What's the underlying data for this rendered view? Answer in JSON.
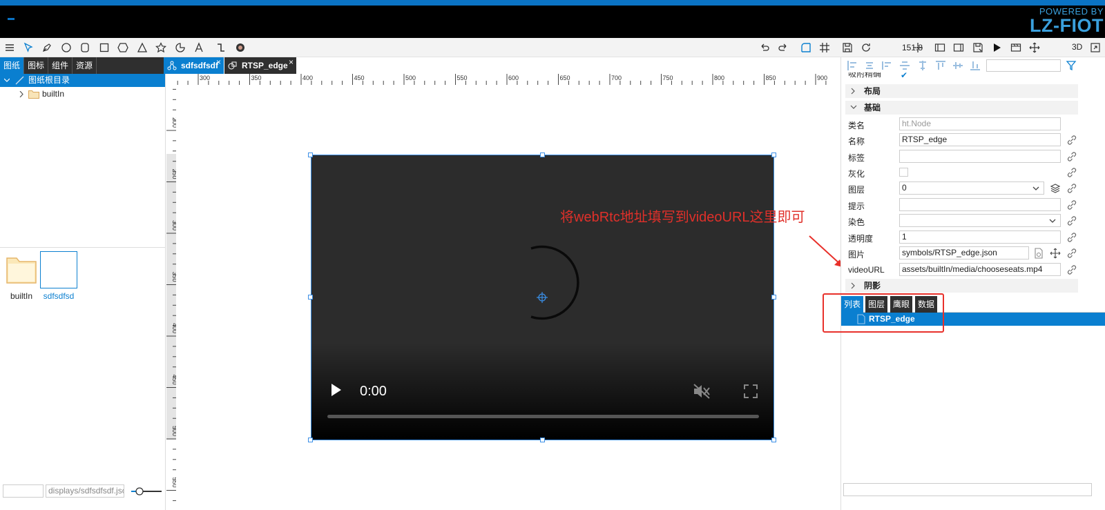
{
  "header": {
    "powered_by": "POWERED BY",
    "brand": "LZ-FIOT"
  },
  "toolbar": {
    "zoom": "151.8",
    "three_d": "3D"
  },
  "left_panel": {
    "tabs": [
      "图纸",
      "图标",
      "组件",
      "资源"
    ],
    "tree_root": "图纸根目录",
    "tree_child": "builtIn",
    "thumbnails": [
      {
        "label": "builtIn"
      },
      {
        "label": "sdfsdfsd"
      }
    ],
    "footer_path": "displays/sdfsdfsdf.json"
  },
  "doc_tabs": [
    {
      "label": "sdfsdfsdf"
    },
    {
      "label": "RTSP_edge"
    }
  ],
  "ruler": {
    "h_labels": [
      "300",
      "350",
      "400",
      "450",
      "500",
      "550",
      "600",
      "650",
      "700",
      "750",
      "800",
      "850",
      "900"
    ],
    "v_labels": [
      "200",
      "250",
      "300",
      "350",
      "400",
      "450",
      "500",
      "550"
    ]
  },
  "video": {
    "time": "0:00",
    "progress": 0
  },
  "annotation": {
    "text": "将webRtc地址填写到videoURL这里即可"
  },
  "properties": {
    "snap_label": "吸附精确",
    "sections": {
      "layout": "布局",
      "basic": "基础",
      "shadow": "阴影"
    },
    "rows": [
      {
        "label": "类名",
        "value": "ht.Node"
      },
      {
        "label": "名称",
        "value": "RTSP_edge"
      },
      {
        "label": "标签",
        "value": ""
      },
      {
        "label": "灰化",
        "value": ""
      },
      {
        "label": "图层",
        "value": "0"
      },
      {
        "label": "提示",
        "value": ""
      },
      {
        "label": "染色",
        "value": ""
      },
      {
        "label": "透明度",
        "value": "1"
      },
      {
        "label": "图片",
        "value": "symbols/RTSP_edge.json"
      },
      {
        "label": "videoURL",
        "value": "assets/builtIn/media/chooseseats.mp4"
      }
    ]
  },
  "bottom_tabs": [
    "列表",
    "图层",
    "鹰眼",
    "数据"
  ],
  "list": {
    "item": "RTSP_edge"
  },
  "colors": {
    "accent": "#0a7fd0",
    "annotation": "#e0302a",
    "tab_dark": "#2f2f2f"
  }
}
